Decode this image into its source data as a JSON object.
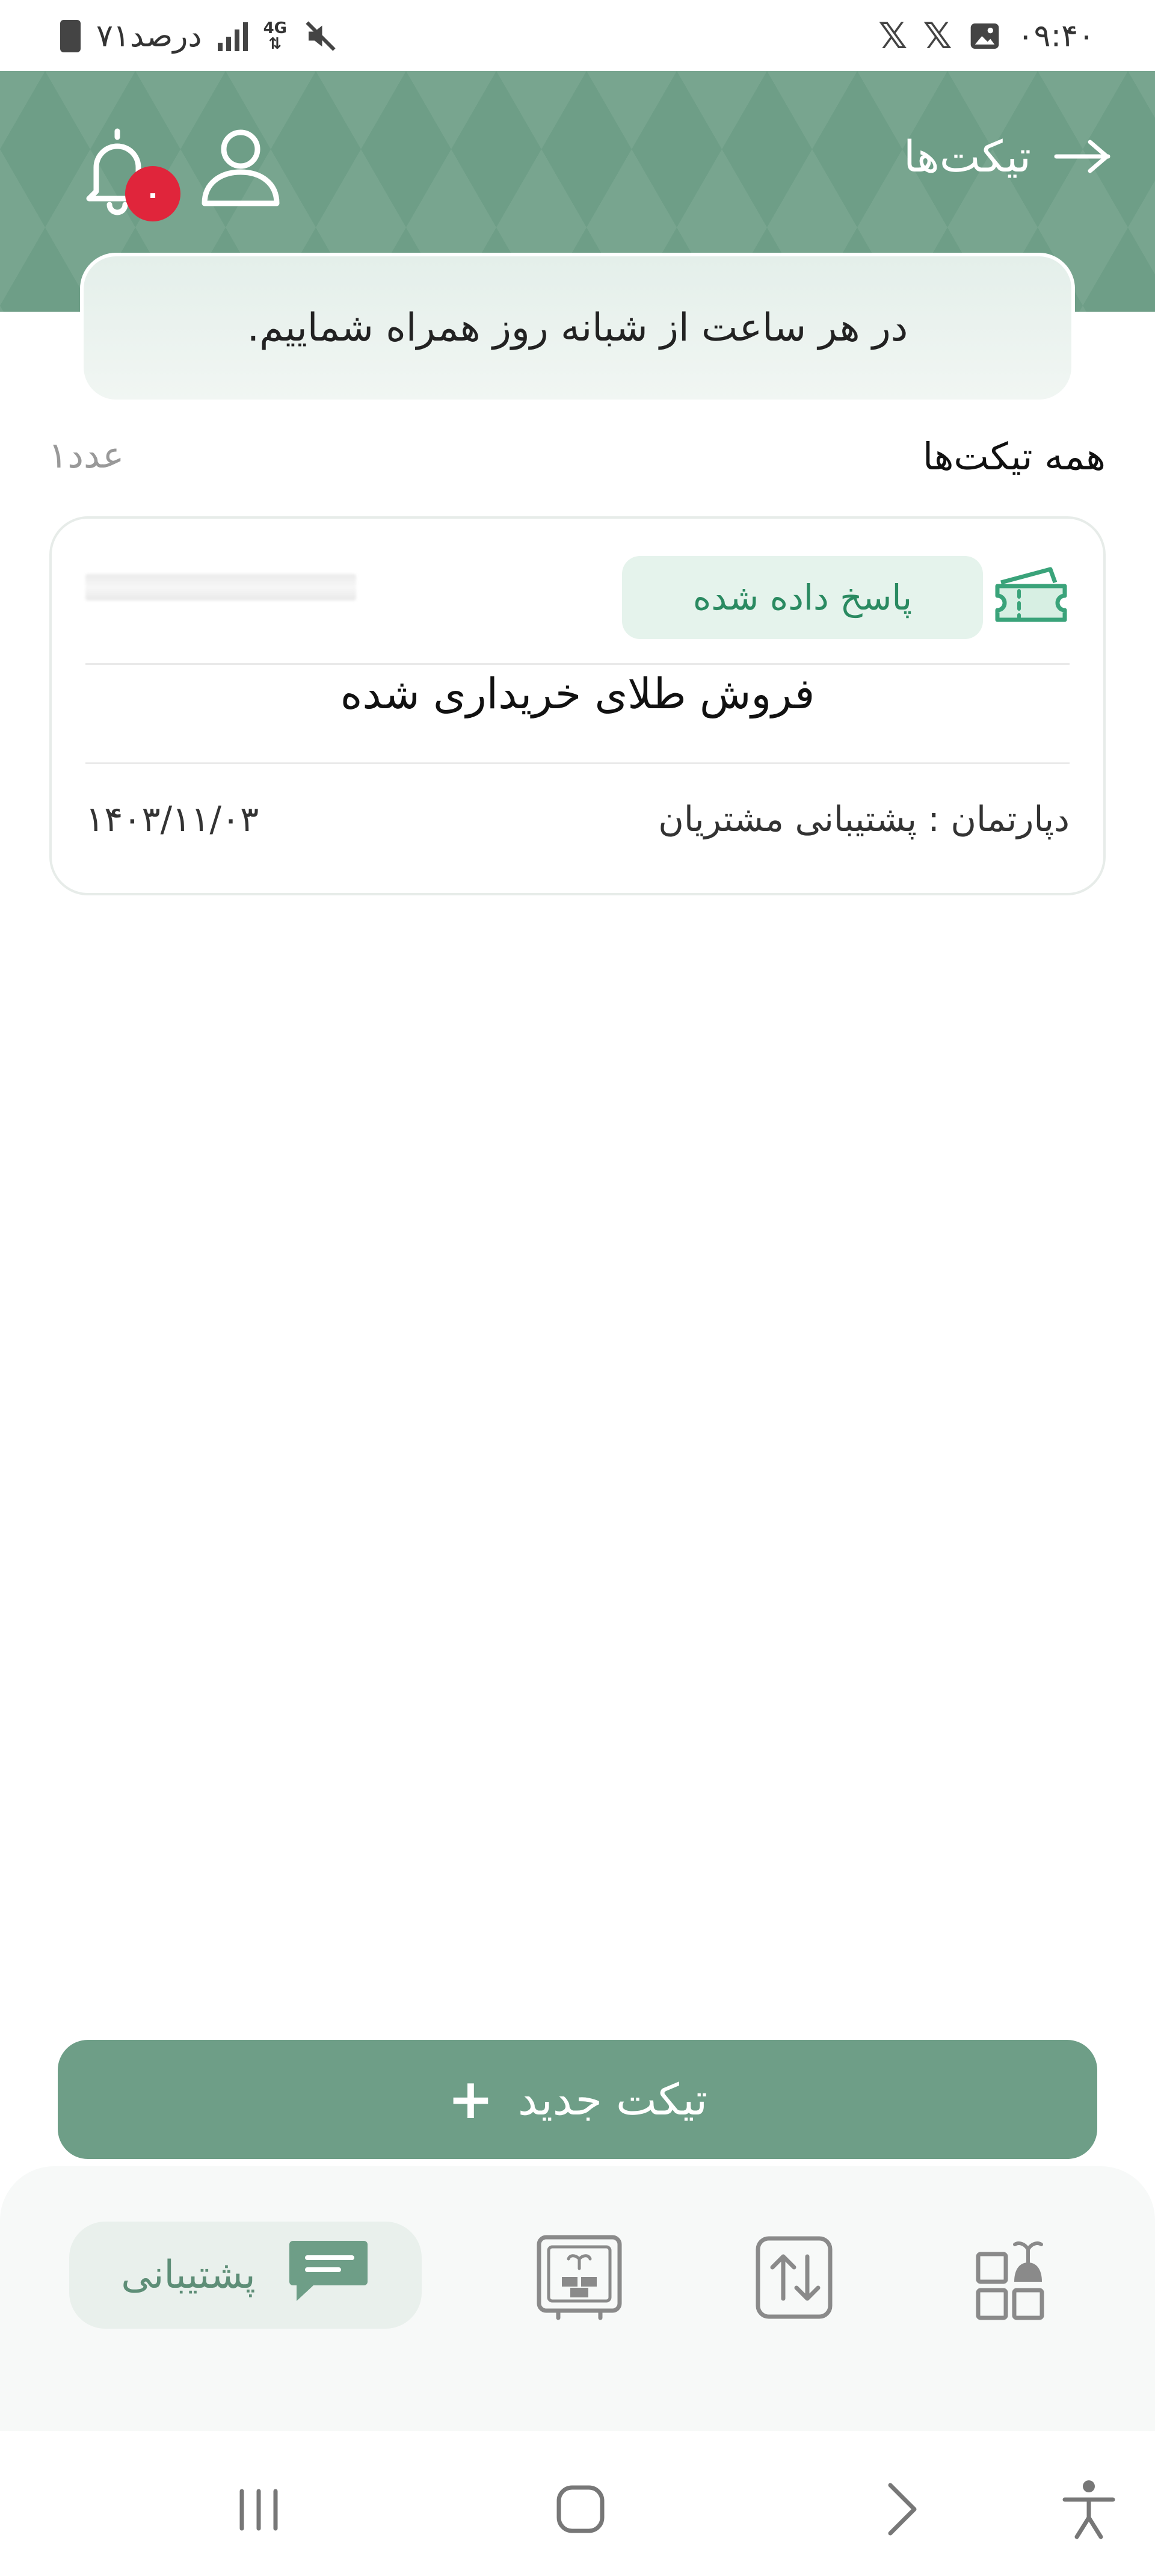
{
  "status_bar": {
    "battery_text": "۷۱درصد",
    "network": "4G",
    "time": "۰۹:۴۰",
    "left_icons": [
      "battery-icon",
      "signal-icon",
      "network-4g-icon",
      "mute-icon"
    ],
    "right_icons": [
      "x-logo-icon",
      "x-logo-icon",
      "image-icon"
    ]
  },
  "header": {
    "title": "تیکت‌ها",
    "notification_count": "۰"
  },
  "banner": {
    "text": "در هر ساعت از شبانه روز همراه شماییم."
  },
  "section": {
    "title": "همه تیکت‌ها",
    "count": "۱عدد"
  },
  "tickets": [
    {
      "status": "پاسخ داده شده",
      "subject": "فروش طلای خریداری شده",
      "department": "دپارتمان : پشتیبانی مشتریان",
      "date": "۱۴۰۳/۱۱/۰۳"
    }
  ],
  "new_ticket_button": {
    "label": "تیکت جدید"
  },
  "bottom_nav": {
    "active_label": "پشتیبانی",
    "items": [
      "support-icon",
      "gold-vault-icon",
      "transfer-icon",
      "dashboard-icon"
    ]
  },
  "colors": {
    "primary": "#6e9e87",
    "status_bg": "#e5f3ec",
    "status_text": "#2a8a61",
    "badge": "#e0253b"
  }
}
